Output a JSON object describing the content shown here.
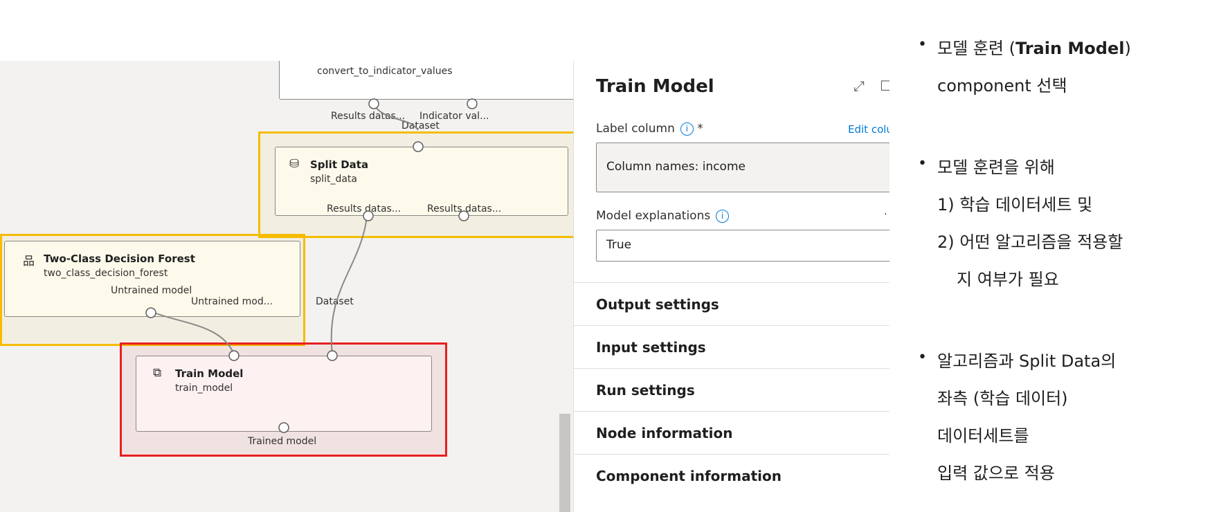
{
  "canvas": {
    "convert_node": {
      "subtitle": "convert_to_indicator_values",
      "port_left": "Results datas...",
      "port_right": "Indicator val..."
    },
    "split_node": {
      "input_label": "Dataset",
      "title": "Split Data",
      "subtitle": "split_data",
      "port_left": "Results datas...",
      "port_right": "Results datas..."
    },
    "forest_node": {
      "title": "Two-Class Decision Forest",
      "subtitle": "two_class_decision_forest",
      "port": "Untrained model"
    },
    "train_node": {
      "input_left": "Untrained mod...",
      "input_right": "Dataset",
      "title": "Train Model",
      "subtitle": "train_model",
      "port": "Trained model"
    }
  },
  "panel": {
    "title": "Train Model",
    "label_column": "Label column",
    "required_mark": "*",
    "edit_link": "Edit colu",
    "label_value": "Column names: income",
    "model_explanations": "Model explanations",
    "explanations_value": "True",
    "info_glyph": "i",
    "sections": [
      "Output settings",
      "Input settings",
      "Run settings",
      "Node information",
      "Component information"
    ]
  },
  "notes": {
    "block1": [
      "모델 훈련 (",
      "Train Model",
      ")",
      "component 선택"
    ],
    "block2": [
      "모델 훈련을 위해",
      "1) 학습 데이터세트 및",
      "2) 어떤 알고리즘을 적용할",
      "지 여부가 필요"
    ],
    "block3": [
      "알고리즘과 Split Data의",
      "좌측 (학습 데이터)",
      "데이터세트를",
      "입력 값으로 적용"
    ]
  },
  "colors": {
    "highlight_yellow": "#f5bc00",
    "highlight_red": "#e81f1f",
    "link_blue": "#0078d4"
  }
}
